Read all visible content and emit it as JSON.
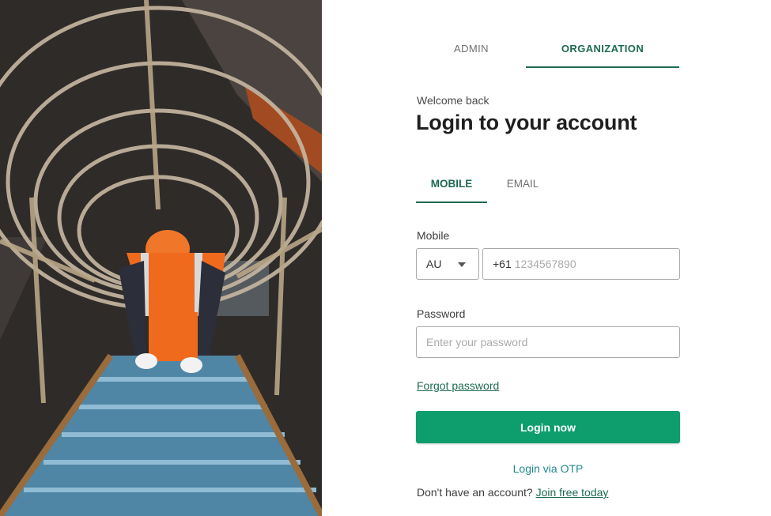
{
  "hero_image": {
    "alt": "Worker climbing caged ladder"
  },
  "role_tabs": [
    {
      "label": "ADMIN",
      "active": false
    },
    {
      "label": "ORGANIZATION",
      "active": true
    }
  ],
  "welcome_text": "Welcome back",
  "title": "Login to your account",
  "method_tabs": [
    {
      "label": "MOBILE",
      "active": true
    },
    {
      "label": "EMAIL",
      "active": false
    }
  ],
  "mobile": {
    "label": "Mobile",
    "country": "AU",
    "prefix": "+61",
    "placeholder": "1234567890",
    "value": ""
  },
  "password": {
    "label": "Password",
    "placeholder": "Enter your password",
    "value": ""
  },
  "forgot_password": "Forgot password",
  "login_button": "Login now",
  "login_otp": "Login via OTP",
  "signup": {
    "prompt": "Don't have an account?",
    "link": "Join free today"
  },
  "colors": {
    "accent": "#1d6b4f",
    "button": "#0e9e6e",
    "otp_link": "#1f8a8a"
  }
}
